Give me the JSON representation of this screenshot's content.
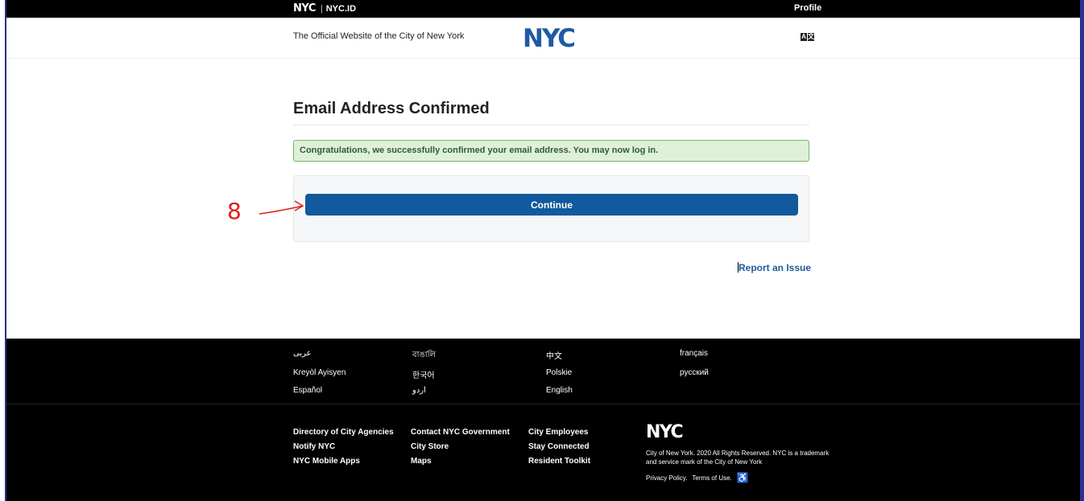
{
  "topbar": {
    "brand_logo": "NYC",
    "brand_sep": "|",
    "brand_text": "NYC.ID",
    "profile": "Profile"
  },
  "header": {
    "tagline": "The Official Website of the City of New York",
    "logo": "NYC",
    "translate_a": "A",
    "translate_b": "文"
  },
  "main": {
    "title": "Email Address Confirmed",
    "alert": "Congratulations, we successfully confirmed your email address. You may now log in.",
    "continue_label": "Continue",
    "report_link": "Report an Issue"
  },
  "annotation": {
    "label": "8"
  },
  "footer": {
    "languages": [
      [
        "عربى",
        "বাঙালি",
        "中文",
        "français"
      ],
      [
        "Kreyòl Ayisyen",
        "한국어",
        "Polskie",
        "русский"
      ],
      [
        "Español",
        "اردو",
        "English",
        ""
      ]
    ],
    "links": [
      [
        "Directory of City Agencies",
        "Contact NYC Government",
        "City Employees"
      ],
      [
        "Notify NYC",
        "City Store",
        "Stay Connected"
      ],
      [
        "NYC Mobile Apps",
        "Maps",
        "Resident Toolkit"
      ]
    ],
    "logo": "NYC",
    "copyright": "City of New York. 2020 All Rights Reserved. NYC is a trademark and service mark of the City of New York",
    "privacy": "Privacy Policy.",
    "terms": "Terms of Use."
  },
  "colors": {
    "brand_blue": "#1f5aa6",
    "button_blue": "#105a9d",
    "alert_bg": "#dff0d8",
    "annotation_red": "#e0201b"
  }
}
